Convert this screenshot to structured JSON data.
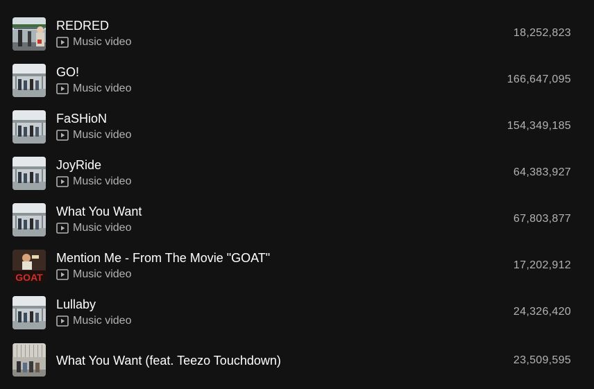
{
  "tracks": [
    {
      "title": "REDRED",
      "subtitle": "Music video",
      "plays": "18,252,823",
      "thumb": "street-photo"
    },
    {
      "title": "GO!",
      "subtitle": "Music video",
      "plays": "166,647,095",
      "thumb": "group-photo"
    },
    {
      "title": "FaSHioN",
      "subtitle": "Music video",
      "plays": "154,349,185",
      "thumb": "group-photo"
    },
    {
      "title": "JoyRide",
      "subtitle": "Music video",
      "plays": "64,383,927",
      "thumb": "group-photo"
    },
    {
      "title": "What You Want",
      "subtitle": "Music video",
      "plays": "67,803,877",
      "thumb": "group-photo"
    },
    {
      "title": "Mention Me - From The Movie \"GOAT\"",
      "subtitle": "Music video",
      "plays": "17,202,912",
      "thumb": "goat-poster",
      "thumb_text": "GOAT"
    },
    {
      "title": "Lullaby",
      "subtitle": "Music video",
      "plays": "24,326,420",
      "thumb": "group-photo"
    },
    {
      "title": "What You Want (feat. Teezo Touchdown)",
      "subtitle": "",
      "plays": "23,509,595",
      "thumb": "album-photo"
    }
  ],
  "colors": {
    "background": "#121212",
    "title": "#ffffff",
    "secondary": "#b3b3b3"
  },
  "icons": {
    "video": "play-in-rectangle-icon"
  }
}
